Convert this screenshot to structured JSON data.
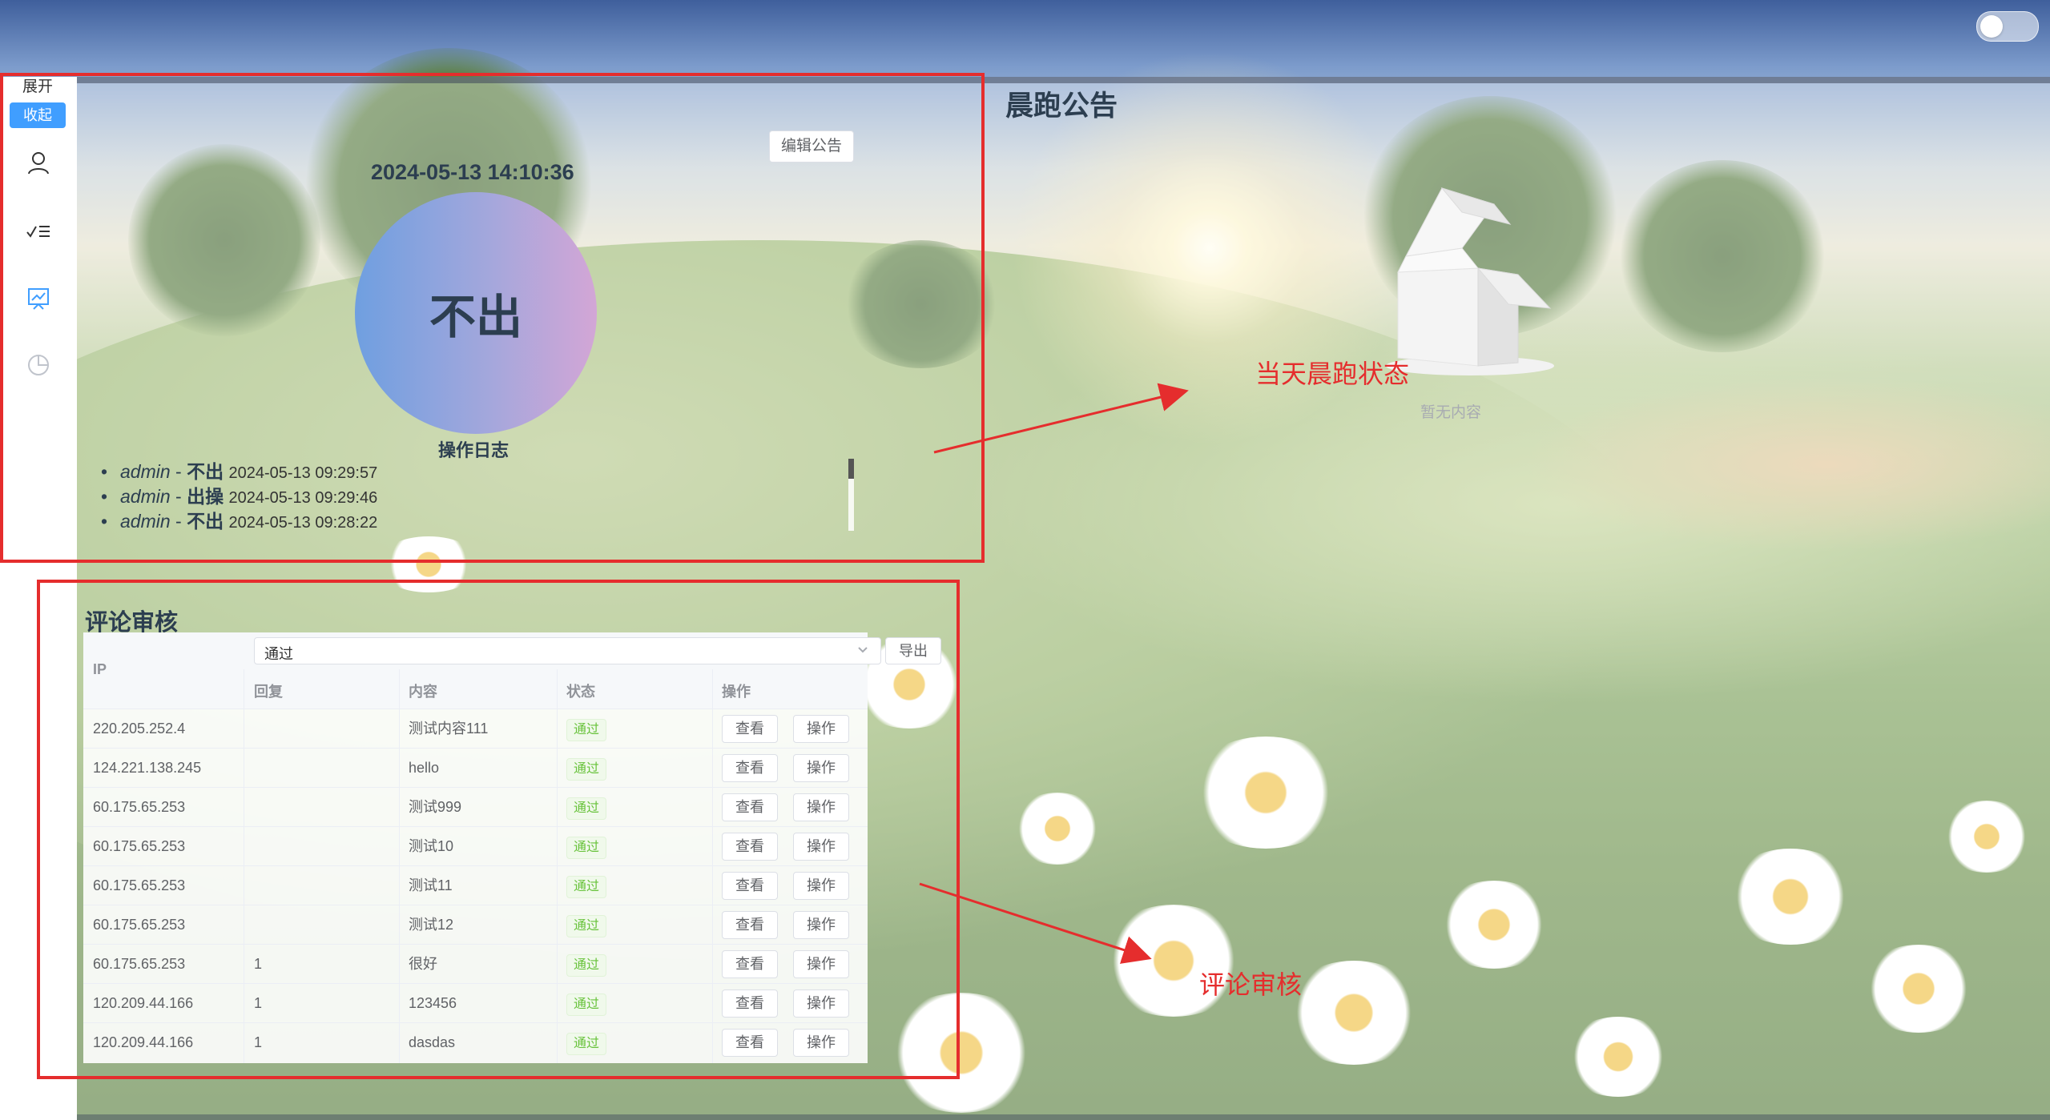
{
  "nav": {
    "expand_label": "展开",
    "collapse_label": "收起",
    "icons": [
      "user-icon",
      "checklist-icon",
      "chart-board-icon",
      "pie-chart-icon"
    ],
    "active_color": "#409eff"
  },
  "status": {
    "datetime": "2024-05-13 14:10:36",
    "state": "不出",
    "edit_button": "编辑公告",
    "log_title": "操作日志",
    "logs": [
      {
        "user": "admin",
        "sep": " - ",
        "action": "不出",
        "time": "2024-05-13 09:29:57"
      },
      {
        "user": "admin",
        "sep": " - ",
        "action": "出操",
        "time": "2024-05-13 09:29:46"
      },
      {
        "user": "admin",
        "sep": " - ",
        "action": "不出",
        "time": "2024-05-13 09:28:22"
      }
    ]
  },
  "announcement": {
    "title": "晨跑公告",
    "empty_text": "暂无内容"
  },
  "annotations": {
    "status_label": "当天晨跑状态",
    "comments_label": "评论审核",
    "color": "#e52d2d"
  },
  "comments": {
    "title": "评论审核",
    "filter_value": "通过",
    "export_button": "导出",
    "columns": {
      "ip": "IP",
      "reply": "回复",
      "content": "内容",
      "status": "状态",
      "actions": "操作"
    },
    "view_button": "查看",
    "action_button": "操作",
    "rows": [
      {
        "ip": "220.205.252.4",
        "reply": "",
        "content": "测试内容111",
        "status": "通过"
      },
      {
        "ip": "124.221.138.245",
        "reply": "",
        "content": "hello",
        "status": "通过"
      },
      {
        "ip": "60.175.65.253",
        "reply": "",
        "content": "测试999",
        "status": "通过"
      },
      {
        "ip": "60.175.65.253",
        "reply": "",
        "content": "测试10",
        "status": "通过"
      },
      {
        "ip": "60.175.65.253",
        "reply": "",
        "content": "测试11",
        "status": "通过"
      },
      {
        "ip": "60.175.65.253",
        "reply": "",
        "content": "测试12",
        "status": "通过"
      },
      {
        "ip": "60.175.65.253",
        "reply": "1",
        "content": "很好",
        "status": "通过"
      },
      {
        "ip": "120.209.44.166",
        "reply": "1",
        "content": "123456",
        "status": "通过"
      },
      {
        "ip": "120.209.44.166",
        "reply": "1",
        "content": "dasdas",
        "status": "通过"
      }
    ]
  }
}
